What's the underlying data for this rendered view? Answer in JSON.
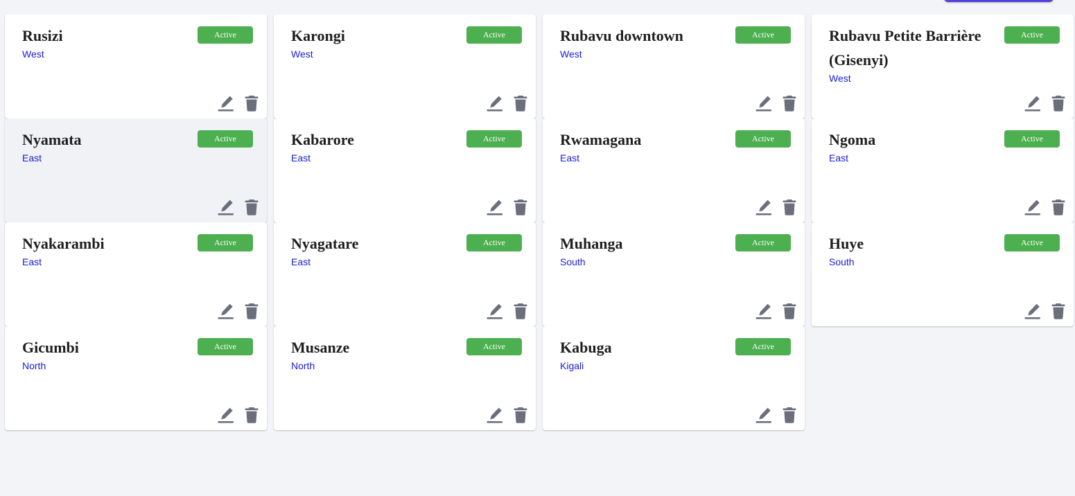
{
  "colors": {
    "background": "#f3f4f7",
    "card": "#ffffff",
    "card_hover": "#f1f2f6",
    "badge": "#4caf50",
    "region_text": "#1a1ad6",
    "icon": "#6b6f7b",
    "top_button": "#5143d9"
  },
  "icons": {
    "edit": "pencil-icon",
    "delete": "trash-icon"
  },
  "sites": [
    {
      "name": "Rusizi",
      "region": "West",
      "status": "Active"
    },
    {
      "name": "Karongi",
      "region": "West",
      "status": "Active"
    },
    {
      "name": "Rubavu downtown",
      "region": "West",
      "status": "Active"
    },
    {
      "name": "Rubavu Petite Barrière (Gisenyi)",
      "region": "West",
      "status": "Active"
    },
    {
      "name": "Nyamata",
      "region": "East",
      "status": "Active"
    },
    {
      "name": "Kabarore",
      "region": "East",
      "status": "Active"
    },
    {
      "name": "Rwamagana",
      "region": "East",
      "status": "Active"
    },
    {
      "name": "Ngoma",
      "region": "East",
      "status": "Active"
    },
    {
      "name": "Nyakarambi",
      "region": "East",
      "status": "Active"
    },
    {
      "name": "Nyagatare",
      "region": "East",
      "status": "Active"
    },
    {
      "name": "Muhanga",
      "region": "South",
      "status": "Active"
    },
    {
      "name": "Huye",
      "region": "South",
      "status": "Active"
    },
    {
      "name": "Gicumbi",
      "region": "North",
      "status": "Active"
    },
    {
      "name": "Musanze",
      "region": "North",
      "status": "Active"
    },
    {
      "name": "Kabuga",
      "region": "Kigali",
      "status": "Active"
    }
  ]
}
